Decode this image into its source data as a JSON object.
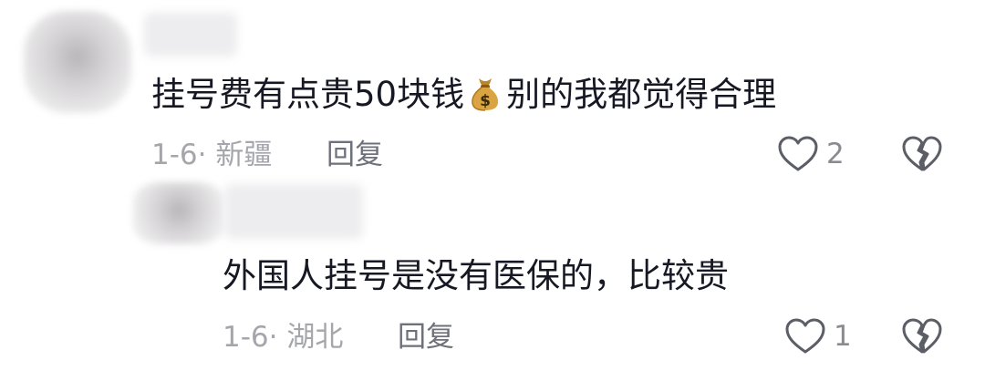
{
  "comments": [
    {
      "text_before_emoji": "挂号费有点贵50块钱",
      "emoji": "money-bag",
      "text_after_emoji": "别的我都觉得合理",
      "date_location": "1-6· 新疆",
      "reply_label": "回复",
      "like_count": "2"
    },
    {
      "text": "外国人挂号是没有医保的，比较贵",
      "date_location": "1-6· 湖北",
      "reply_label": "回复",
      "like_count": "1"
    }
  ],
  "icons": {
    "like": "heart-outline-icon",
    "dislike": "broken-heart-icon"
  },
  "colors": {
    "primary_text": "#161823",
    "meta_text": "#a5a6ac",
    "reply_text": "#6e707a",
    "icon": "#5c5e66"
  }
}
